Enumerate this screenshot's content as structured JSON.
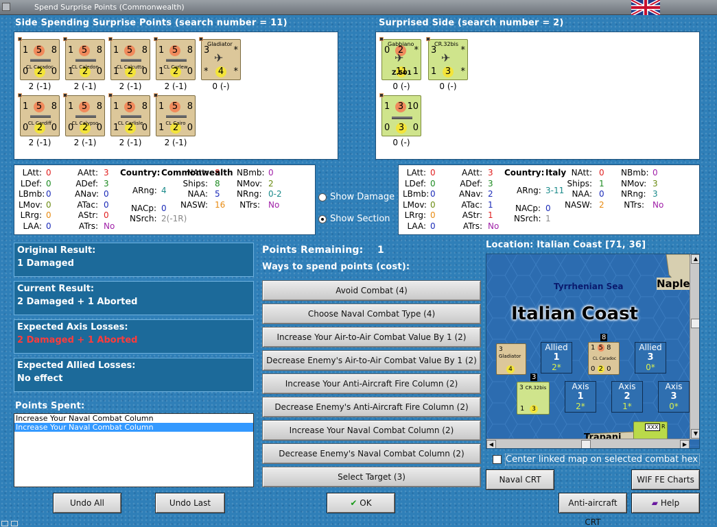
{
  "window": {
    "title": "Spend Surprise Points (Commonwealth)"
  },
  "left_panel": {
    "header": "Side Spending Surprise Points (search number = 11)",
    "units": [
      {
        "name": "CL Caradoc",
        "att": "1",
        "mid": "5",
        "def": "8",
        "b1": "0",
        "b2": "2",
        "b3": "0",
        "label": "2 (-1)"
      },
      {
        "name": "CL Caledon",
        "att": "1",
        "mid": "5",
        "def": "8",
        "b1": "1",
        "b2": "2",
        "b3": "0",
        "label": "2 (-1)"
      },
      {
        "name": "CL Calcutta",
        "att": "1",
        "mid": "5",
        "def": "8",
        "b1": "1",
        "b2": "2",
        "b3": "0",
        "label": "2 (-1)"
      },
      {
        "name": "CL Curlew",
        "att": "1",
        "mid": "5",
        "def": "8",
        "b1": "1",
        "b2": "2",
        "b3": "0",
        "label": "2 (-1)"
      },
      {
        "name": "Gladiator",
        "att": "3",
        "mid": "",
        "def": "*",
        "b1": "*",
        "b2": "4",
        "b3": "*",
        "label": "0 (-)"
      },
      {
        "name": "CL Cardiff",
        "att": "1",
        "mid": "5",
        "def": "8",
        "b1": "0",
        "b2": "2",
        "b3": "0",
        "label": "2 (-1)"
      },
      {
        "name": "CL Calypso",
        "att": "1",
        "mid": "5",
        "def": "8",
        "b1": "0",
        "b2": "2",
        "b3": "0",
        "label": "2 (-1)"
      },
      {
        "name": "CL Carlisle",
        "att": "1",
        "mid": "5",
        "def": "8",
        "b1": "1",
        "b2": "2",
        "b3": "0",
        "label": "2 (-1)"
      },
      {
        "name": "CL Cairo",
        "att": "1",
        "mid": "5",
        "def": "8",
        "b1": "1",
        "b2": "2",
        "b3": "0",
        "label": "2 (-1)"
      }
    ]
  },
  "right_panel": {
    "header": "Surprised Side (search number = 2)",
    "units": [
      {
        "name": "Gabbiano",
        "sub": "Z.501",
        "att": "0",
        "mid": "2",
        "def": "*",
        "b1": "",
        "b2": "11",
        "b3": "1",
        "label": "0 (-)"
      },
      {
        "name": "CR.32bis",
        "att": "3",
        "mid": "",
        "def": "*",
        "b1": "1",
        "b2": "3",
        "b3": "*",
        "label": "0 (-)"
      },
      {
        "name": "",
        "att": "1",
        "mid": "3",
        "def": "10",
        "b1": "0",
        "b2": "3",
        "b3": "0",
        "label": "0 (-)"
      }
    ]
  },
  "stats_cw": {
    "country_label": "Country:",
    "country": "Commonwealth",
    "rows": [
      [
        "LAtt:",
        "0",
        "AAtt:",
        "3",
        "NAtt:",
        "8",
        "NBmb:",
        "0"
      ],
      [
        "LDef:",
        "0",
        "ADef:",
        "3",
        "Ships:",
        "8",
        "NMov:",
        "2"
      ],
      [
        "LBmb:",
        "0",
        "ANav:",
        "0",
        "NAA:",
        "5",
        "NRng:",
        "0-2"
      ],
      [
        "LMov:",
        "0",
        "ATac:",
        "0",
        "NASW:",
        "16",
        "NTrs:",
        "No"
      ],
      [
        "LRrg:",
        "0",
        "AStr:",
        "0",
        "",
        ""
      ],
      [
        "LAA:",
        "0",
        "ATrs:",
        "No",
        "",
        ""
      ]
    ],
    "arng_label": "ARng:",
    "arng": "4",
    "nacp_label": "NACp:",
    "nacp": "0",
    "nsrch_label": "NSrch:",
    "nsrch": "2(-1R)"
  },
  "stats_it": {
    "country_label": "Country:",
    "country": "Italy",
    "rows": [
      [
        "LAtt:",
        "0",
        "AAtt:",
        "3",
        "NAtt:",
        "0",
        "NBmb:",
        "0"
      ],
      [
        "LDef:",
        "0",
        "ADef:",
        "3",
        "Ships:",
        "1",
        "NMov:",
        "3"
      ],
      [
        "LBmb:",
        "0",
        "ANav:",
        "2",
        "NAA:",
        "0",
        "NRng:",
        "3"
      ],
      [
        "LMov:",
        "0",
        "ATac:",
        "1",
        "NASW:",
        "2",
        "NTrs:",
        "No"
      ],
      [
        "LRrg:",
        "0",
        "AStr:",
        "1",
        "",
        ""
      ],
      [
        "LAA:",
        "0",
        "ATrs:",
        "No",
        "",
        ""
      ]
    ],
    "arng_label": "ARng:",
    "arng": "3-11",
    "nacp_label": "NACp:",
    "nacp": "0",
    "nsrch_label": "NSrch:",
    "nsrch": "1"
  },
  "options": {
    "show_damage": "Show Damage",
    "show_section": "Show Section"
  },
  "results": {
    "original_title": "Original Result:",
    "original_value": "1 Damaged",
    "current_title": "Current Result:",
    "current_value": "2 Damaged + 1 Aborted",
    "axis_title": "Expected Axis Losses:",
    "axis_value": "2 Damaged + 1 Aborted",
    "allied_title": "Expected Allied Losses:",
    "allied_value": "No effect"
  },
  "points_spent": {
    "title": "Points Spent:",
    "items": [
      "Increase Your Naval Combat Column",
      "Increase Your Naval Combat Column"
    ]
  },
  "points": {
    "remaining_label": "Points Remaining:",
    "remaining": "1",
    "ways_label": "Ways to spend points (cost):"
  },
  "spend_buttons": [
    "Avoid Combat (4)",
    "Choose Naval Combat Type (4)",
    "Increase Your Air-to-Air Combat Value By 1 (2)",
    "Decrease Enemy's Air-to-Air Combat Value By 1 (2)",
    "Increase Your Anti-Aircraft Fire Column (2)",
    "Decrease Enemy's Anti-Aircraft Fire Column (2)",
    "Increase Your Naval Combat Column (2)",
    "Decrease Enemy's Naval Combat Column (2)",
    "Select Target (3)"
  ],
  "map": {
    "location_label": "Location: Italian Coast [71, 36]",
    "sea": "Tyrrhenian Sea",
    "coast": "Italian Coast",
    "naples": "Naple",
    "trapani": "Trapani",
    "boxes": [
      {
        "side": "Allied",
        "n": "1",
        "s": "2*"
      },
      {
        "side": "Allied",
        "n": "3",
        "s": "0*"
      },
      {
        "side": "Axis",
        "n": "1",
        "s": "2*"
      },
      {
        "side": "Axis",
        "n": "2",
        "s": "1*"
      },
      {
        "side": "Axis",
        "n": "3",
        "s": "0*"
      }
    ],
    "glad": "Gladiator",
    "glad_att": "3",
    "glad_b": "4",
    "cr": "CR.32bis",
    "cr_att": "3",
    "cr_b1": "1",
    "cr_b2": "3",
    "cara": "CL Caradoc",
    "stack3": "3",
    "stack8": "8",
    "xxx": "XXX",
    "r": "R"
  },
  "center_linked": "Center linked map on selected combat hex",
  "buttons": {
    "naval_crt": "Naval CRT",
    "wif_charts": "WIF FE Charts",
    "aa_crt": "Anti-aircraft CRT",
    "help": "Help",
    "undo_all": "Undo All",
    "undo_last": "Undo Last",
    "ok": "OK"
  }
}
